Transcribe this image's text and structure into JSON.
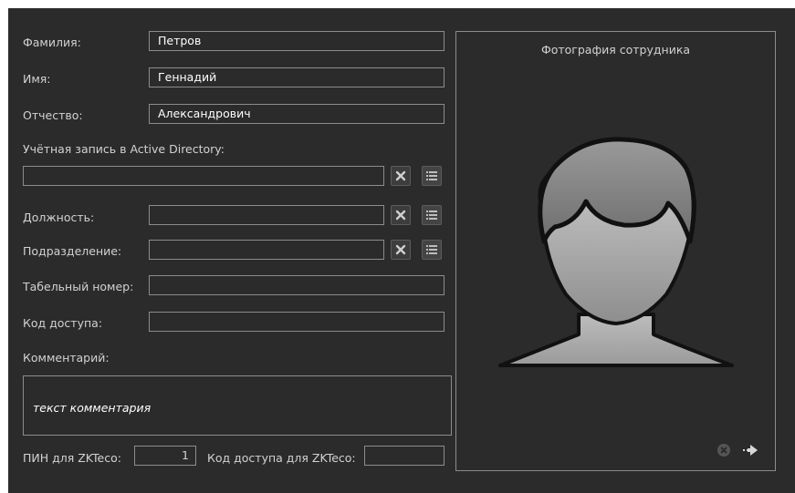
{
  "form": {
    "last_name": {
      "label": "Фамилия:",
      "value": "Петров"
    },
    "first_name": {
      "label": "Имя:",
      "value": "Геннадий"
    },
    "patronymic": {
      "label": "Отчество:",
      "value": "Александрович"
    },
    "ad_account": {
      "label": "Учётная запись в Active Directory:",
      "value": ""
    },
    "position": {
      "label": "Должность:",
      "value": ""
    },
    "department": {
      "label": "Подразделение:",
      "value": ""
    },
    "personnel_number": {
      "label": "Табельный номер:",
      "value": ""
    },
    "access_code": {
      "label": "Код доступа:",
      "value": ""
    },
    "comment": {
      "label": "Комментарий:",
      "value": "текст комментария"
    },
    "zk_pin": {
      "label": "ПИН для ZKTeco:",
      "value": "1"
    },
    "zk_access_code": {
      "label": "Код доступа для ZKTeco:",
      "value": ""
    }
  },
  "photo": {
    "title": "Фотография сотрудника"
  },
  "icons": {
    "clear": "close-x-icon",
    "select": "list-icon",
    "photo_clear": "remove-circle-icon",
    "photo_load": "import-arrow-icon"
  },
  "colors": {
    "background": "#2b2b2b",
    "border": "#8c8c8c",
    "text": "#d2d2d2",
    "value_text": "#ffffff"
  }
}
